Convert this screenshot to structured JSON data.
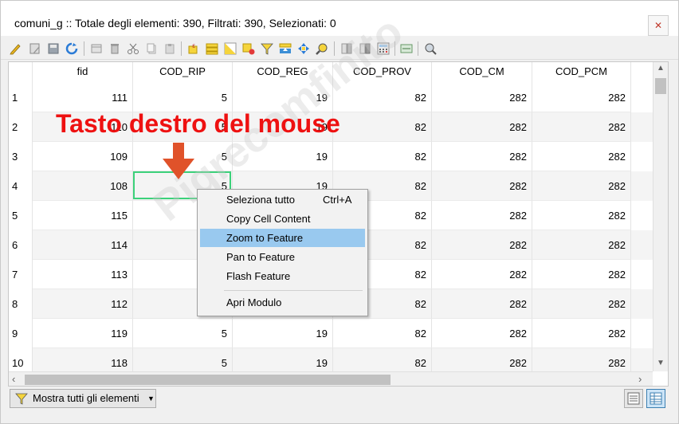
{
  "window": {
    "title": "comuni_g :: Totale degli elementi: 390, Filtrati: 390, Selezionati: 0",
    "close_label": "✕"
  },
  "toolbar": {
    "icons": [
      "pencil-icon",
      "multi-edit-icon",
      "save-icon",
      "reload-icon",
      "add-feature-icon",
      "delete-icon",
      "cut-icon",
      "copy-icon",
      "paste-icon",
      "select-by-expression-icon",
      "select-all-icon",
      "invert-selection-icon",
      "deselect-icon",
      "filter-icon",
      "move-selection-top-icon",
      "pan-to-selected-icon",
      "zoom-to-selected-icon",
      "new-field-icon",
      "delete-field-icon",
      "field-calculator-icon",
      "conditional-formatting-icon",
      "actions-icon",
      "dock-icon"
    ]
  },
  "table": {
    "columns": [
      "fid",
      "COD_RIP",
      "COD_REG",
      "COD_PROV",
      "COD_CM",
      "COD_PCM"
    ],
    "rows": [
      {
        "num": "1",
        "cells": [
          "111",
          "5",
          "19",
          "82",
          "282",
          "282"
        ]
      },
      {
        "num": "2",
        "cells": [
          "110",
          "5",
          "19",
          "82",
          "282",
          "282"
        ]
      },
      {
        "num": "3",
        "cells": [
          "109",
          "5",
          "19",
          "82",
          "282",
          "282"
        ]
      },
      {
        "num": "4",
        "cells": [
          "108",
          "5",
          "19",
          "82",
          "282",
          "282"
        ]
      },
      {
        "num": "5",
        "cells": [
          "115",
          "",
          "",
          "82",
          "282",
          "282"
        ]
      },
      {
        "num": "6",
        "cells": [
          "114",
          "",
          "",
          "82",
          "282",
          "282"
        ]
      },
      {
        "num": "7",
        "cells": [
          "113",
          "",
          "",
          "82",
          "282",
          "282"
        ]
      },
      {
        "num": "8",
        "cells": [
          "112",
          "",
          "",
          "82",
          "282",
          "282"
        ]
      },
      {
        "num": "9",
        "cells": [
          "119",
          "5",
          "19",
          "82",
          "282",
          "282"
        ]
      },
      {
        "num": "10",
        "cells": [
          "118",
          "5",
          "19",
          "82",
          "282",
          "282"
        ]
      }
    ]
  },
  "annotation": {
    "text": "Tasto destro del mouse",
    "color": "#ee1111"
  },
  "watermark": {
    "text": "Pigrecomfinito"
  },
  "context_menu": {
    "items": [
      {
        "label": "Seleziona tutto",
        "shortcut": "Ctrl+A",
        "highlighted": false
      },
      {
        "label": "Copy Cell Content",
        "shortcut": "",
        "highlighted": false
      },
      {
        "label": "Zoom to Feature",
        "shortcut": "",
        "highlighted": true
      },
      {
        "label": "Pan to Feature",
        "shortcut": "",
        "highlighted": false
      },
      {
        "label": "Flash Feature",
        "shortcut": "",
        "highlighted": false
      },
      {
        "label": "Apri Modulo",
        "shortcut": "",
        "highlighted": false
      }
    ]
  },
  "bottombar": {
    "filter_label": "Mostra tutti gli elementi",
    "view_buttons": [
      "form-view-icon",
      "table-view-icon"
    ]
  },
  "colors": {
    "selection_border": "#3cd17a",
    "menu_highlight": "#99c9ef",
    "arrow": "#e0522a"
  }
}
